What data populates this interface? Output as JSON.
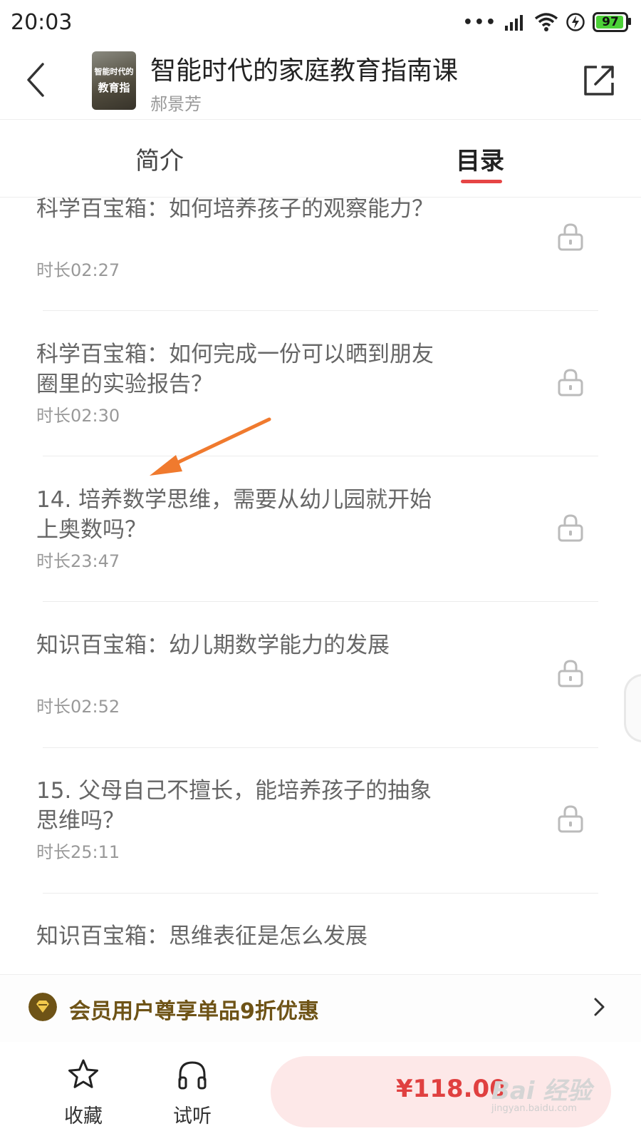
{
  "status_bar": {
    "time": "20:03",
    "battery": "97",
    "dots": "•••"
  },
  "header": {
    "title": "智能时代的家庭教育指南课",
    "author": "郝景芳",
    "cover_line1": "智能时代的",
    "cover_line2": "教育指"
  },
  "tabs": [
    {
      "label": "简介"
    },
    {
      "label": "目录"
    }
  ],
  "active_tab": "目录",
  "episodes": [
    {
      "title": "科学百宝箱：如何培养孩子的观察能力？",
      "duration": "时长02:27",
      "locked": true
    },
    {
      "title": "科学百宝箱：如何完成一份可以晒到朋友圈里的实验报告？",
      "duration": "时长02:30",
      "locked": true
    },
    {
      "title": "14. 培养数学思维，需要从幼儿园就开始上奥数吗？",
      "duration": "时长23:47",
      "locked": true
    },
    {
      "title": "知识百宝箱：幼儿期数学能力的发展",
      "duration": "时长02:52",
      "locked": true
    },
    {
      "title": "15. 父母自己不擅长，能培养孩子的抽象思维吗？",
      "duration": "时长25:11",
      "locked": true
    },
    {
      "title": "知识百宝箱：思维表征是怎么发展",
      "duration": "",
      "locked": true
    }
  ],
  "member_banner": {
    "text": "会员用户尊享单品9折优惠"
  },
  "bottom_bar": {
    "favorite_label": "收藏",
    "listen_label": "试听",
    "price": "¥118.00"
  },
  "watermark": {
    "main": "Bai 经验",
    "sub": "jingyan.baidu.com"
  },
  "colors": {
    "accent": "#e64545",
    "member_gold": "#6e5316",
    "buy_bg": "#fde8e8",
    "annotation_arrow": "#f07a2e"
  }
}
